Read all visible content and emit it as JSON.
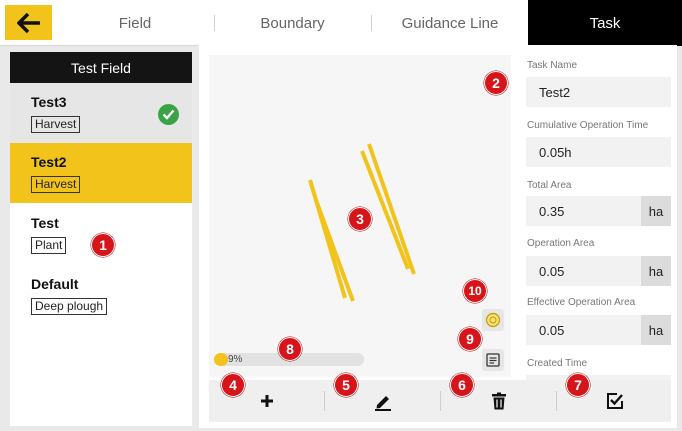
{
  "tabs": [
    {
      "label": "Field"
    },
    {
      "label": "Boundary"
    },
    {
      "label": "Guidance Line"
    },
    {
      "label": "Task"
    }
  ],
  "field": {
    "name": "Test Field",
    "tasks": [
      {
        "name": "Test3",
        "type": "Harvest",
        "status": "completed"
      },
      {
        "name": "Test2",
        "type": "Harvest",
        "status": "selected"
      },
      {
        "name": "Test",
        "type": "Plant",
        "status": ""
      },
      {
        "name": "Default",
        "type": "Deep plough",
        "status": ""
      }
    ]
  },
  "map": {
    "progress_label": "9%",
    "progress_value": 0.09
  },
  "details": {
    "task_name_label": "Task Name",
    "task_name_value": "Test2",
    "cumulative_time_label": "Cumulative Operation Time",
    "cumulative_time_value": "0.05h",
    "total_area_label": "Total Area",
    "total_area_value": "0.35",
    "operation_area_label": "Operation Area",
    "operation_area_value": "0.05",
    "effective_area_label": "Effective Operation Area",
    "effective_area_value": "0.05",
    "area_unit": "ha",
    "created_time_label": "Created Time"
  },
  "toolbar": {
    "icons": [
      "plus-icon",
      "pencil-icon",
      "trash-icon",
      "checkbox-icon"
    ]
  },
  "markers": [
    "1",
    "2",
    "3",
    "4",
    "5",
    "6",
    "7",
    "8",
    "9",
    "10"
  ],
  "colors": {
    "accent": "#f2c31a",
    "header": "#141414",
    "marker": "#d8141b",
    "complete": "#3aa346"
  }
}
